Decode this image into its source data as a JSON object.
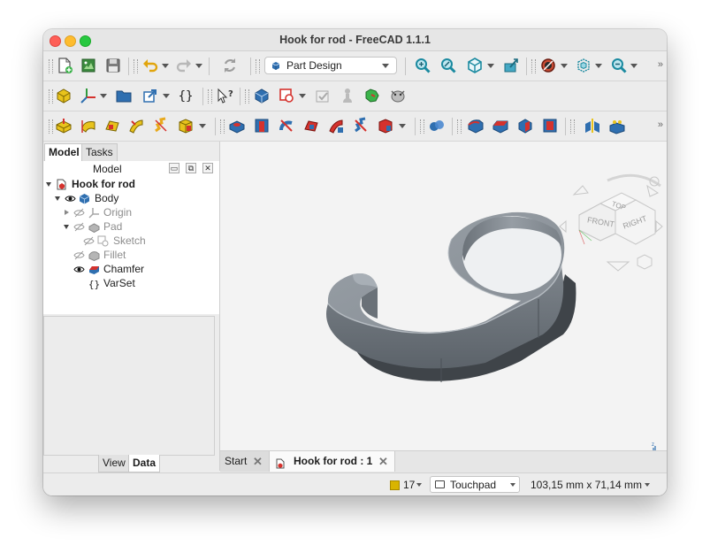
{
  "window": {
    "title": "Hook for rod - FreeCAD 1.1.1"
  },
  "toolbar": {
    "workbench": "Part Design",
    "overflow_glyph": "»"
  },
  "combo_view": {
    "tabs": [
      "Model",
      "Tasks"
    ],
    "header_label": "Model",
    "bottom_tabs": [
      "View",
      "Data"
    ]
  },
  "tree": {
    "document": "Hook for rod",
    "body": "Body",
    "origin": "Origin",
    "pad": "Pad",
    "sketch": "Sketch",
    "fillet": "Fillet",
    "chamfer": "Chamfer",
    "varset": "VarSet"
  },
  "navcube": {
    "top": "TOP",
    "front": "FRONT",
    "right": "RIGHT"
  },
  "doc_tabs": {
    "start": "Start",
    "document": "Hook for rod : 1",
    "close_glyph": "✕"
  },
  "status": {
    "count": "17",
    "navigation_style": "Touchpad",
    "dimensions": "103,15 mm x 71,14 mm"
  },
  "colors": {
    "model_grey": "#7c838a",
    "accent_blue": "#2f6fb0",
    "feature_red": "#d5322d",
    "feature_yellow": "#e9c21c"
  }
}
